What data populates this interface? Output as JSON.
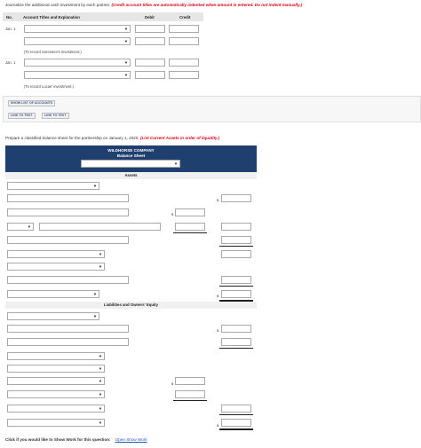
{
  "instructions": {
    "journal": "Journalize the additional cash investment by each partner.",
    "journal_note": "(Credit account titles are automatically indented when amount is entered. Do not indent manually.)",
    "balance_sheet": "Prepare a classified balance sheet for the partnership on January 1, 2020.",
    "balance_sheet_note": "(List Current Assets in order of liquidity.)"
  },
  "journal_table": {
    "headers": {
      "no": "No.",
      "account": "Account Titles and Explanation",
      "debit": "Debit",
      "credit": "Credit"
    },
    "entries": [
      {
        "date": "Jan. 1",
        "note": "(To record Sorensen's investment.)"
      },
      {
        "date": "Jan. 1",
        "note": "(To record Lucas' investment.)"
      }
    ]
  },
  "buttons": {
    "show_list": "SHOW LIST OF ACCOUNTS",
    "link_to_text_1": "LINK TO TEXT",
    "link_to_text_2": "LINK TO TEXT"
  },
  "balance_sheet": {
    "company": "WILDHORSE COMPANY",
    "title": "Balance Sheet",
    "assets_label": "Assets",
    "liabilities_label": "Liabilities and Owners' Equity"
  },
  "currency_symbol": "$",
  "footer": {
    "prompt": "Click if you would like to Show Work for this question:",
    "link": "Open Show Work"
  }
}
